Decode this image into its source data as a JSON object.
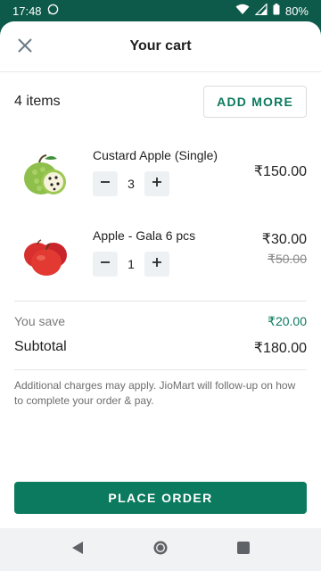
{
  "status": {
    "time": "17:48",
    "battery": "80%",
    "icons": [
      "whatsapp-icon",
      "wifi-icon",
      "signal-icon",
      "battery-icon"
    ]
  },
  "header": {
    "title": "Your cart",
    "close_icon": "close-icon"
  },
  "cart": {
    "items_count": "4 items",
    "add_more_label": "ADD MORE",
    "items": [
      {
        "name": "Custard Apple (Single)",
        "quantity": "3",
        "price": "₹150.00",
        "image": "custard-apple-image"
      },
      {
        "name": "Apple - Gala 6 pcs",
        "quantity": "1",
        "price": "₹30.00",
        "old_price": "₹50.00",
        "image": "apple-gala-image"
      }
    ]
  },
  "summary": {
    "save_label": "You save",
    "save_value": "₹20.00",
    "subtotal_label": "Subtotal",
    "subtotal_value": "₹180.00",
    "note": "Additional charges may apply. JioMart will follow-up on how to complete your order & pay."
  },
  "actions": {
    "place_order_label": "PLACE ORDER"
  },
  "colors": {
    "brand_green": "#0b7a5e",
    "status_bar": "#0d5a4a"
  },
  "nav": [
    "back-icon",
    "home-icon",
    "recents-icon"
  ]
}
